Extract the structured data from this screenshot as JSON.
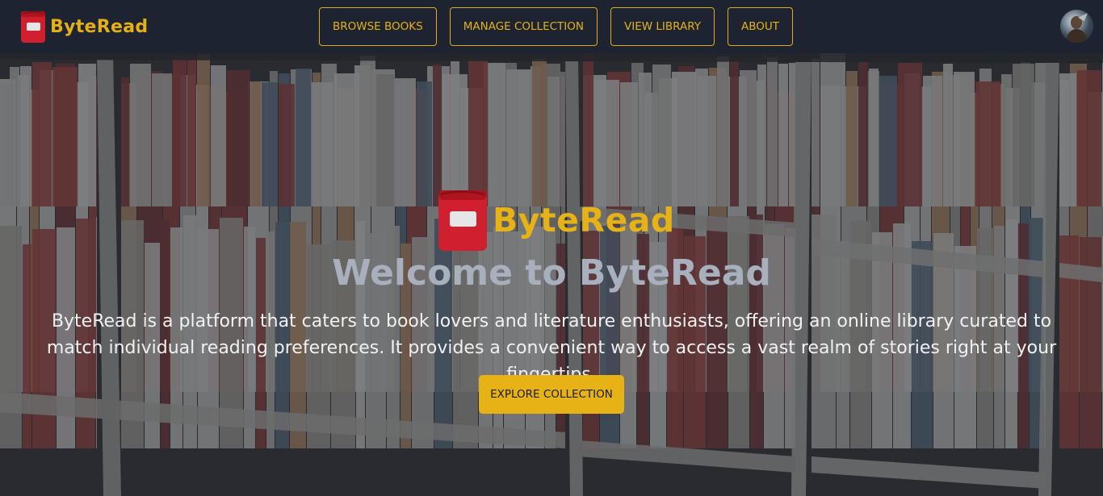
{
  "navbar": {
    "brand_name": "ByteRead",
    "links": [
      {
        "label": "BROWSE BOOKS"
      },
      {
        "label": "MANAGE COLLECTION"
      },
      {
        "label": "VIEW LIBRARY"
      },
      {
        "label": "ABOUT"
      }
    ],
    "avatar_icon": "user-avatar-icon"
  },
  "hero": {
    "logo_name": "ByteRead",
    "title": "Welcome to ByteRead",
    "description": "ByteRead is a platform that caters to book lovers and literature enthusiasts, offering an online library curated to match individual reading preferences. It provides a convenient way to access a vast realm of stories right at your fingertips.",
    "cta_label": "EXPLORE COLLECTION",
    "background_icon": "bookshelf-background"
  },
  "colors": {
    "accent": "#e6b216",
    "navbar_bg": "#1d2330",
    "logo_red": "#d01f2e",
    "title_gray": "#a9b0bd"
  }
}
